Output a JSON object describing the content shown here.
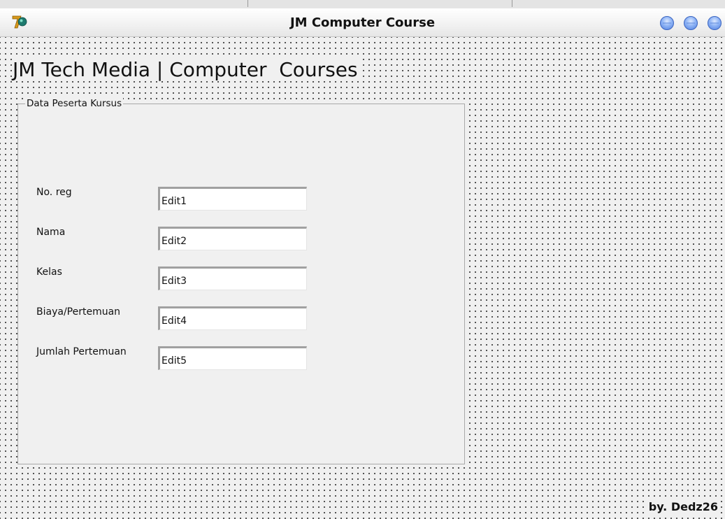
{
  "window": {
    "title": "JM Computer Course"
  },
  "form": {
    "heading": "JM Tech Media | Computer  Courses",
    "groupbox_caption": "Data Peserta Kursus",
    "fields": [
      {
        "label": "No. reg",
        "value": "Edit1"
      },
      {
        "label": "Nama",
        "value": "Edit2"
      },
      {
        "label": "Kelas",
        "value": "Edit3"
      },
      {
        "label": "Biaya/Pertemuan",
        "value": "Edit4"
      },
      {
        "label": "Jumlah Pertemuan",
        "value": "Edit5"
      }
    ],
    "credit": "by. Dedz26"
  },
  "colors": {
    "form_background": "#f0f0f0",
    "window_button": "#6f9ae8",
    "grid_dot": "#2a2a2a"
  },
  "icons": {
    "app": "delphi-icon",
    "window_buttons": [
      "minimize-icon",
      "maximize-icon",
      "close-icon"
    ]
  }
}
